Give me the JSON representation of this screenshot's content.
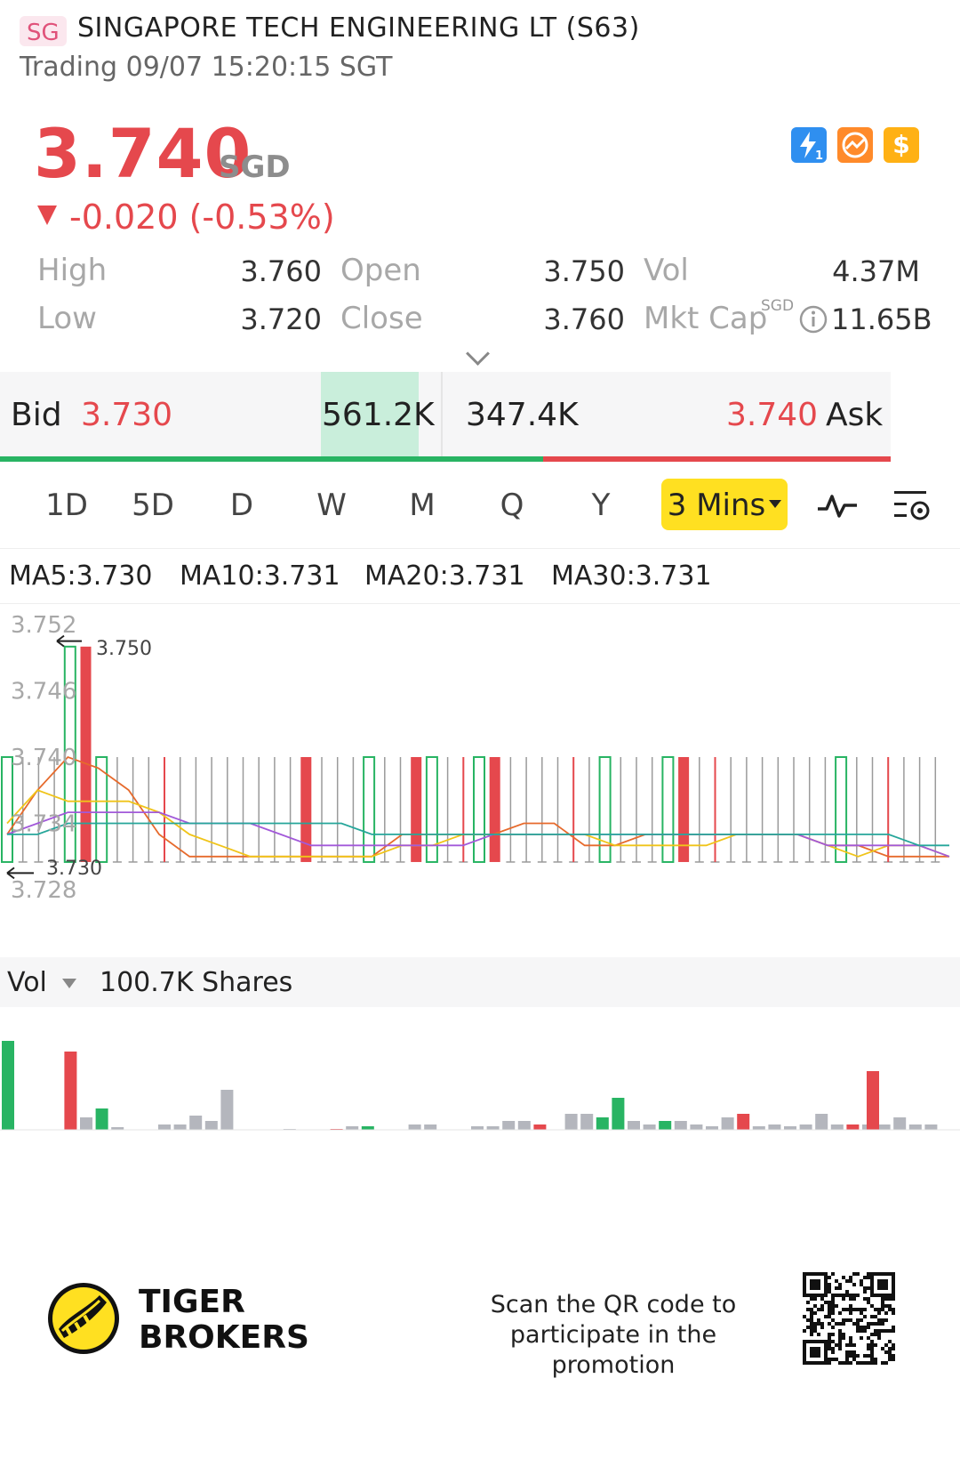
{
  "header": {
    "market_badge": "SG",
    "title": "SINGAPORE TECH ENGINEERING LT (S63)",
    "status": "Trading 09/07 15:20:15 SGT"
  },
  "quote": {
    "price": "3.740",
    "currency": "SGD",
    "change": "-0.020 (-0.53%)",
    "change_color": "#e5484d"
  },
  "header_icons": [
    {
      "name": "lightning-level1-icon",
      "color": "#2f8ff0"
    },
    {
      "name": "trend-badge-icon",
      "color": "#ff8a2a"
    },
    {
      "name": "dollar-icon",
      "color": "#ffb114"
    }
  ],
  "stats": {
    "high_label": "High",
    "high_value": "3.760",
    "low_label": "Low",
    "low_value": "3.720",
    "open_label": "Open",
    "open_value": "3.750",
    "close_label": "Close",
    "close_value": "3.760",
    "vol_label": "Vol",
    "vol_value": "4.37M",
    "mktcap_label": "Mkt Cap",
    "mktcap_currency": "SGD",
    "mktcap_value": "11.65B"
  },
  "bidask": {
    "bid_label": "Bid",
    "bid_price": "3.730",
    "bid_volume": "561.2K",
    "ask_volume": "347.4K",
    "ask_price": "3.740",
    "ask_label": "Ask",
    "bid_share": 0.61
  },
  "periods": [
    "1D",
    "5D",
    "D",
    "W",
    "M",
    "Q",
    "Y"
  ],
  "active_period": "3 Mins",
  "moving_averages": [
    {
      "label": "MA5:3.730",
      "color": "#e66a2c"
    },
    {
      "label": "MA10:3.731",
      "color": "#f0c419"
    },
    {
      "label": "MA20:3.731",
      "color": "#a259d9"
    },
    {
      "label": "MA30:3.731",
      "color": "#26a69a"
    }
  ],
  "chart_data": {
    "type": "candlestick",
    "y_ticks": [
      "3.752",
      "3.746",
      "3.740",
      "3.734",
      "3.728"
    ],
    "ylim": [
      3.728,
      3.752
    ],
    "max_label": "3.750",
    "min_label": "3.730"
  },
  "volume": {
    "label": "Vol",
    "value": "100.7K Shares"
  },
  "footer": {
    "brand_line1": "TIGER",
    "brand_line2": "BROKERS",
    "promo_line1": "Scan the QR code to",
    "promo_line2": "participate in the promotion"
  }
}
